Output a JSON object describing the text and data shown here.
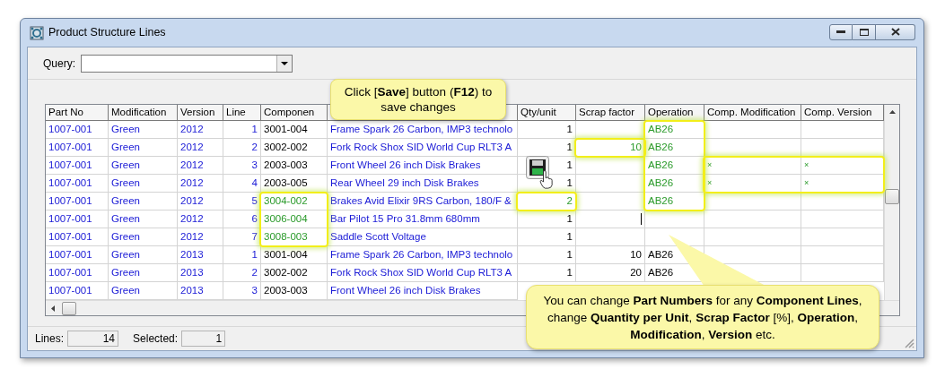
{
  "window": {
    "title": "Product Structure Lines"
  },
  "query": {
    "label": "Query:"
  },
  "table": {
    "columns": [
      {
        "label": "Part No",
        "kind": "link"
      },
      {
        "label": "Modification",
        "kind": "link"
      },
      {
        "label": "Version",
        "kind": "link"
      },
      {
        "label": "Line",
        "kind": "link"
      },
      {
        "label": "Componen",
        "kind": "plain"
      },
      {
        "kind": "link"
      },
      {
        "label": "Qty/unit",
        "kind": "plain"
      },
      {
        "label": "Scrap factor",
        "kind": "plain"
      },
      {
        "label": "Operation",
        "kind": "plain"
      },
      {
        "label": "Comp. Modification",
        "kind": "plain"
      },
      {
        "label": "Comp. Version",
        "kind": "plain"
      }
    ],
    "rows": [
      {
        "cells": [
          {
            "text": "1007-001",
            "edited": false
          },
          {
            "text": "Green",
            "edited": false
          },
          {
            "text": "2012",
            "edited": false
          },
          {
            "text": "1",
            "edited": false
          },
          {
            "text": "3001-004",
            "edited": false
          },
          {
            "text": "Frame Spark 26 Carbon, IMP3 technolo",
            "edited": false
          },
          {
            "text": "1",
            "edited": false
          },
          null,
          {
            "text": "AB26",
            "edited": true
          },
          null,
          null
        ]
      },
      {
        "cells": [
          {
            "text": "1007-001",
            "edited": false
          },
          {
            "text": "Green",
            "edited": false
          },
          {
            "text": "2012",
            "edited": false
          },
          {
            "text": "2",
            "edited": false
          },
          {
            "text": "3002-002",
            "edited": false
          },
          {
            "text": "Fork Rock Shox SID World Cup RLT3 A",
            "edited": false
          },
          {
            "text": "1",
            "edited": false
          },
          {
            "text": "10",
            "edited": true
          },
          {
            "text": "AB26",
            "edited": true
          },
          null,
          null
        ]
      },
      {
        "cells": [
          {
            "text": "1007-001",
            "edited": false
          },
          {
            "text": "Green",
            "edited": false
          },
          {
            "text": "2012",
            "edited": false
          },
          {
            "text": "3",
            "edited": false
          },
          {
            "text": "2003-003",
            "edited": false
          },
          {
            "text": "Front Wheel 26 inch Disk Brakes",
            "edited": false
          },
          {
            "text": "1",
            "edited": false
          },
          null,
          {
            "text": "AB26",
            "edited": true
          },
          {
            "text": "×",
            "edited": true
          },
          {
            "text": "×",
            "edited": true
          }
        ]
      },
      {
        "cells": [
          {
            "text": "1007-001",
            "edited": false
          },
          {
            "text": "Green",
            "edited": false
          },
          {
            "text": "2012",
            "edited": false
          },
          {
            "text": "4",
            "edited": false
          },
          {
            "text": "2003-005",
            "edited": false
          },
          {
            "text": "Rear Wheel 29 inch Disk Brakes",
            "edited": false
          },
          {
            "text": "1",
            "edited": false
          },
          null,
          {
            "text": "AB26",
            "edited": true
          },
          {
            "text": "×",
            "edited": true
          },
          {
            "text": "×",
            "edited": true
          }
        ]
      },
      {
        "cells": [
          {
            "text": "1007-001",
            "edited": false
          },
          {
            "text": "Green",
            "edited": false
          },
          {
            "text": "2012",
            "edited": false
          },
          {
            "text": "5",
            "edited": false
          },
          {
            "text": "3004-002",
            "edited": true
          },
          {
            "text": "Brakes Avid Elixir 9RS Carbon, 180/F &",
            "edited": false
          },
          {
            "text": "2",
            "edited": true
          },
          null,
          {
            "text": "AB26",
            "edited": true
          },
          null,
          null
        ]
      },
      {
        "cells": [
          {
            "text": "1007-001",
            "edited": false
          },
          {
            "text": "Green",
            "edited": false
          },
          {
            "text": "2012",
            "edited": false
          },
          {
            "text": "6",
            "edited": false
          },
          {
            "text": "3006-004",
            "edited": true
          },
          {
            "text": "Bar Pilot 15 Pro 31.8mm 680mm",
            "edited": false
          },
          {
            "text": "1",
            "edited": false
          },
          {
            "cursor": true
          },
          null,
          null,
          null
        ]
      },
      {
        "cells": [
          {
            "text": "1007-001",
            "edited": false
          },
          {
            "text": "Green",
            "edited": false
          },
          {
            "text": "2012",
            "edited": false
          },
          {
            "text": "7",
            "edited": false
          },
          {
            "text": "3008-003",
            "edited": true
          },
          {
            "text": "Saddle Scott Voltage",
            "edited": false
          },
          {
            "text": "1",
            "edited": false
          },
          null,
          null,
          null,
          null
        ]
      },
      {
        "cells": [
          {
            "text": "1007-001",
            "edited": false
          },
          {
            "text": "Green",
            "edited": false
          },
          {
            "text": "2013",
            "edited": false
          },
          {
            "text": "1",
            "edited": false
          },
          {
            "text": "3001-004",
            "edited": false
          },
          {
            "text": "Frame Spark 26 Carbon, IMP3 technolo",
            "edited": false
          },
          {
            "text": "1",
            "edited": false
          },
          {
            "text": "10",
            "edited": false
          },
          {
            "text": "AB26",
            "edited": false
          },
          null,
          null
        ]
      },
      {
        "cells": [
          {
            "text": "1007-001",
            "edited": false
          },
          {
            "text": "Green",
            "edited": false
          },
          {
            "text": "2013",
            "edited": false
          },
          {
            "text": "2",
            "edited": false
          },
          {
            "text": "3002-002",
            "edited": false
          },
          {
            "text": "Fork Rock Shox SID World Cup RLT3 A",
            "edited": false
          },
          {
            "text": "1",
            "edited": false
          },
          {
            "text": "20",
            "edited": false
          },
          {
            "text": "AB26",
            "edited": false
          },
          null,
          null
        ]
      },
      {
        "cells": [
          {
            "text": "1007-001",
            "edited": false
          },
          {
            "text": "Green",
            "edited": false
          },
          {
            "text": "2013",
            "edited": false
          },
          {
            "text": "3",
            "edited": false
          },
          {
            "text": "2003-003",
            "edited": false
          },
          {
            "text": "Front Wheel 26 inch Disk Brakes",
            "edited": false
          }
        ]
      }
    ]
  },
  "status_bar": {
    "lines_label": "Lines:",
    "lines": "14",
    "selected_label": "Selected:",
    "selected": "1"
  },
  "callouts": [
    {
      "kind": "top",
      "text": "Click [**Save**] button (**F12**) to save changes"
    },
    {
      "kind": "bottom",
      "text": "You can change **Part Numbers** for any **Component Lines**, change **Quantity per Unit**, **Scrap Factor** [%], **Operation**, **Modification**, **Version** etc."
    }
  ]
}
